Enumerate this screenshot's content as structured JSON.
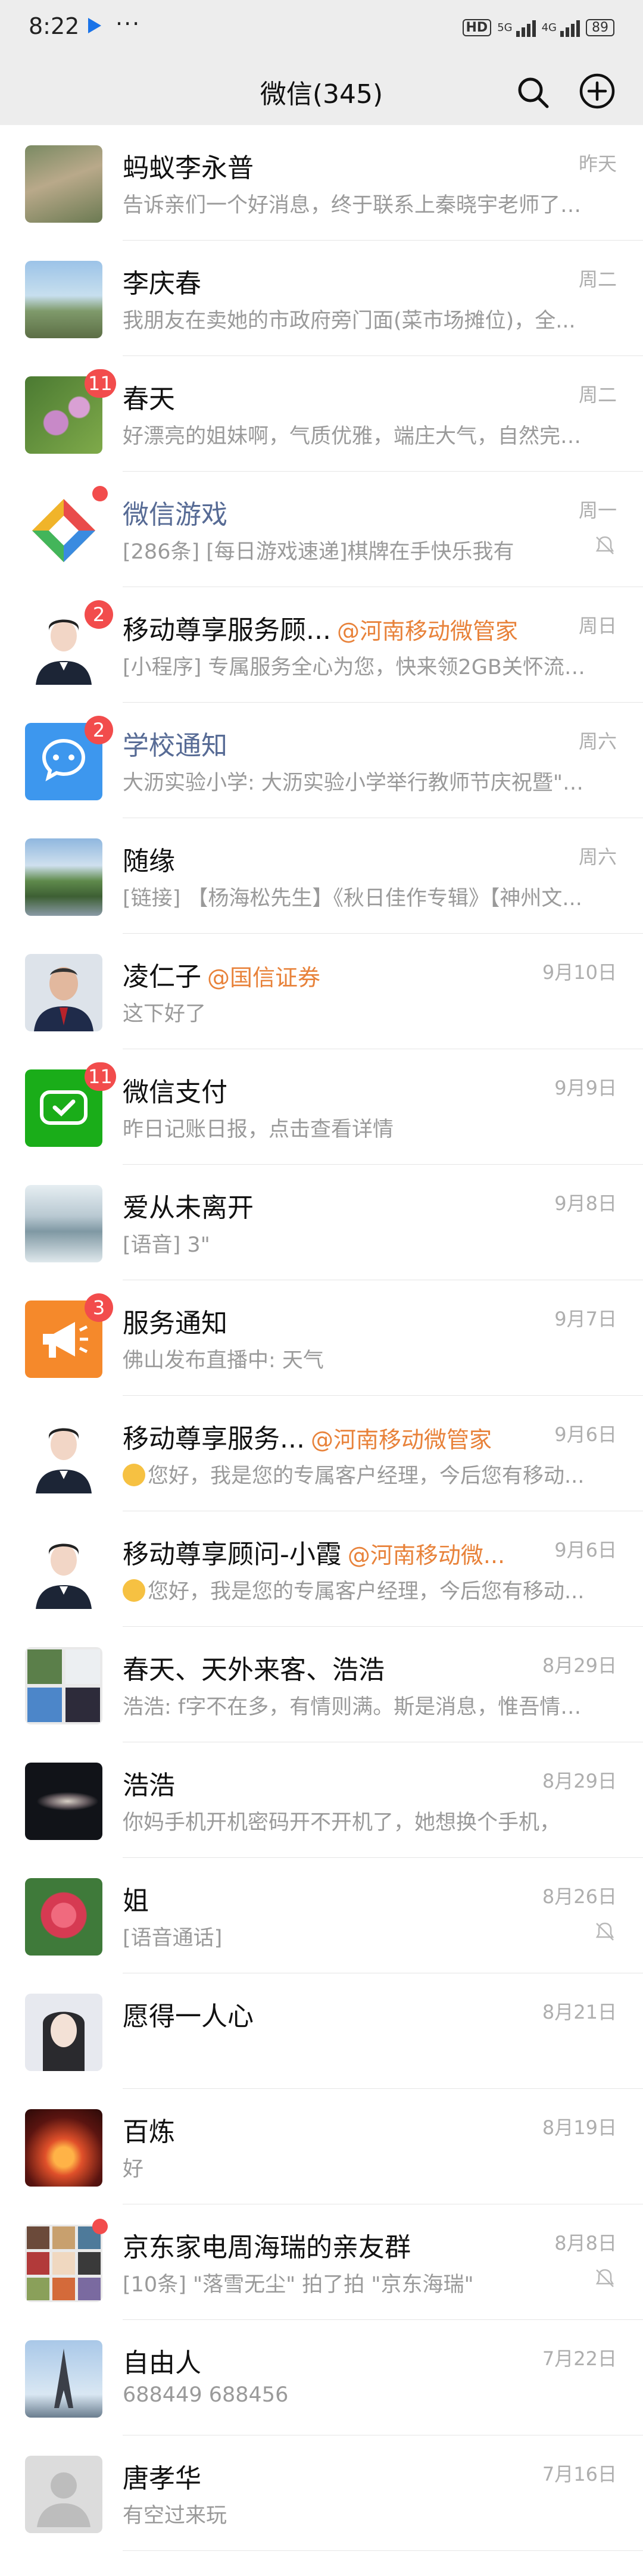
{
  "status_bar": {
    "time": "8:22",
    "dots": "···",
    "hd": "HD",
    "net1": "5G",
    "net2": "4G",
    "battery": "89"
  },
  "header": {
    "title": "微信(345)"
  },
  "chats": [
    {
      "name": "蚂蚁李永普",
      "tag": "",
      "message": "告诉亲们一个好消息，终于联系上秦晓宇老师了！...",
      "time": "昨天",
      "badge": "",
      "dot": false,
      "muted": false,
      "blue": false
    },
    {
      "name": "李庆春",
      "tag": "",
      "message": "我朋友在卖她的市政府旁门面(菜市场摊位)，全...",
      "time": "周二",
      "badge": "",
      "dot": false,
      "muted": false,
      "blue": false
    },
    {
      "name": "春天",
      "tag": "",
      "message": "好漂亮的姐妹啊，气质优雅，端庄大气，自然完美...",
      "time": "周二",
      "badge": "11",
      "dot": false,
      "muted": false,
      "blue": false
    },
    {
      "name": "微信游戏",
      "tag": "",
      "message": "[286条] [每日游戏速递]棋牌在手快乐我有",
      "time": "周一",
      "badge": "",
      "dot": true,
      "muted": true,
      "blue": true
    },
    {
      "name": "移动尊享服务顾...",
      "tag": "@河南移动微管家",
      "message": "[小程序] 专属服务全心为您，快来领2GB关怀流量...",
      "time": "周日",
      "badge": "2",
      "dot": false,
      "muted": false,
      "blue": false
    },
    {
      "name": "学校通知",
      "tag": "",
      "message": "大沥实验小学: 大沥实验小学举行教师节庆祝暨\"美...",
      "time": "周六",
      "badge": "2",
      "dot": false,
      "muted": false,
      "blue": true
    },
    {
      "name": "随缘",
      "tag": "",
      "message": "[链接] 【杨海松先生】《秋日佳作专辑》【神州文...",
      "time": "周六",
      "badge": "",
      "dot": false,
      "muted": false,
      "blue": false
    },
    {
      "name": "凌仁子",
      "tag": "@国信证券",
      "message": "这下好了",
      "time": "9月10日",
      "badge": "",
      "dot": false,
      "muted": false,
      "blue": false
    },
    {
      "name": "微信支付",
      "tag": "",
      "message": "昨日记账日报，点击查看详情",
      "time": "9月9日",
      "badge": "11",
      "dot": false,
      "muted": false,
      "blue": false
    },
    {
      "name": "爱从未离开",
      "tag": "",
      "message": "[语音] 3\"",
      "time": "9月8日",
      "badge": "",
      "dot": false,
      "muted": false,
      "blue": false
    },
    {
      "name": "服务通知",
      "tag": "",
      "message": "佛山发布直播中: 天气",
      "time": "9月7日",
      "badge": "3",
      "dot": false,
      "muted": false,
      "blue": false
    },
    {
      "name": "移动尊享服务...",
      "tag": "@河南移动微管家",
      "message": "您好，我是您的专属客户经理，今后您有移动...",
      "time": "9月6日",
      "badge": "",
      "dot": false,
      "muted": false,
      "blue": false,
      "emoji": true
    },
    {
      "name": "移动尊享顾问-小霞",
      "tag": "@河南移动微...",
      "message": "您好，我是您的专属客户经理，今后您有移动...",
      "time": "9月6日",
      "badge": "",
      "dot": false,
      "muted": false,
      "blue": false,
      "emoji": true
    },
    {
      "name": "春天、天外来客、浩浩",
      "tag": "",
      "message": "浩浩: f字不在多，有情则满。斯是消息，惟吾情深...",
      "time": "8月29日",
      "badge": "",
      "dot": false,
      "muted": false,
      "blue": false
    },
    {
      "name": "浩浩",
      "tag": "",
      "message": "你妈手机开机密码开不开机了，她想换个手机，",
      "time": "8月29日",
      "badge": "",
      "dot": false,
      "muted": false,
      "blue": false
    },
    {
      "name": "姐",
      "tag": "",
      "message": "[语音通话]",
      "time": "8月26日",
      "badge": "",
      "dot": false,
      "muted": true,
      "blue": false
    },
    {
      "name": "愿得一人心",
      "tag": "",
      "message": "",
      "time": "8月21日",
      "badge": "",
      "dot": false,
      "muted": false,
      "blue": false
    },
    {
      "name": "百炼",
      "tag": "",
      "message": "好",
      "time": "8月19日",
      "badge": "",
      "dot": false,
      "muted": false,
      "blue": false
    },
    {
      "name": "京东家电周海瑞的亲友群",
      "tag": "",
      "message": "[10条] \"落雪无尘\" 拍了拍 \"京东海瑞\"",
      "time": "8月8日",
      "badge": "",
      "dot": true,
      "muted": true,
      "blue": false
    },
    {
      "name": "自由人",
      "tag": "",
      "message": "688449      688456",
      "time": "7月22日",
      "badge": "",
      "dot": false,
      "muted": false,
      "blue": false
    },
    {
      "name": "唐孝华",
      "tag": "",
      "message": "有空过来玩",
      "time": "7月16日",
      "badge": "",
      "dot": false,
      "muted": false,
      "blue": false
    }
  ],
  "colors": {
    "badge": "#f24c4c",
    "official_name": "#576b95",
    "mention_tag": "#e8823a",
    "header_bg": "#ededed"
  }
}
